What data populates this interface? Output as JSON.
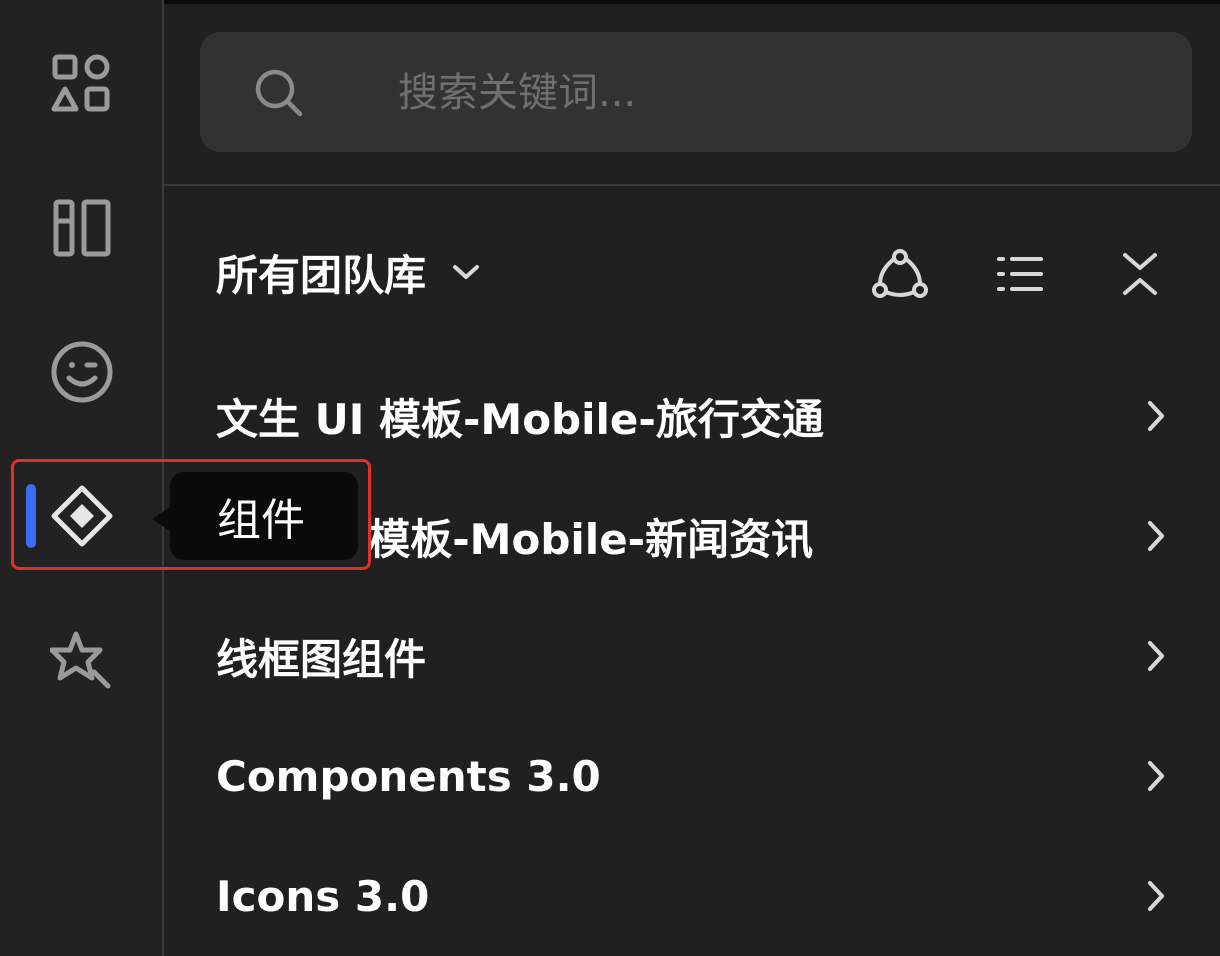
{
  "tooltip": {
    "label": "组件"
  },
  "rail": {
    "items": [
      {
        "icon": "shapes-icon"
      },
      {
        "icon": "layout-icon"
      },
      {
        "icon": "emoji-icon"
      },
      {
        "icon": "component-icon",
        "active": true
      },
      {
        "icon": "star-wand-icon"
      }
    ],
    "accent": "#3b6cf6"
  },
  "search": {
    "placeholder": "搜索关键词..."
  },
  "library": {
    "selector_label": "所有团队库",
    "items": [
      {
        "label": "文生 UI 模板-Mobile-旅行交通"
      },
      {
        "label": "I 模板-Mobile-新闻资讯"
      },
      {
        "label": "线框图组件"
      },
      {
        "label": "Components 3.0"
      },
      {
        "label": "Icons 3.0"
      }
    ]
  },
  "colors": {
    "background": "#202020",
    "search_bg": "#323232",
    "highlight": "#e0302b"
  }
}
